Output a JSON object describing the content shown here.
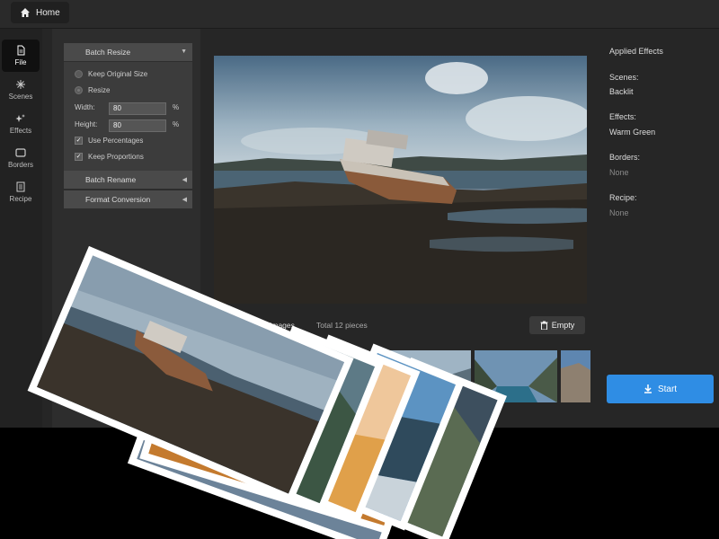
{
  "topbar": {
    "home_label": "Home",
    "home_icon": "home-icon"
  },
  "rail": {
    "items": [
      {
        "label": "File",
        "icon": "file-icon",
        "active": true
      },
      {
        "label": "Scenes",
        "icon": "sparkle-icon"
      },
      {
        "label": "Effects",
        "icon": "effects-icon"
      },
      {
        "label": "Borders",
        "icon": "border-icon"
      },
      {
        "label": "Recipe",
        "icon": "recipe-icon"
      }
    ]
  },
  "batch_resize": {
    "title": "Batch Resize",
    "keep_original_label": "Keep Original Size",
    "resize_label": "Resize",
    "width_label": "Width:",
    "width_value": "80",
    "height_label": "Height:",
    "height_value": "80",
    "unit": "%",
    "use_percentages_label": "Use Percentages",
    "use_percentages_checked": true,
    "keep_proportions_label": "Keep Proportions",
    "keep_proportions_checked": true
  },
  "batch_rename": {
    "title": "Batch Rename"
  },
  "format_conversion": {
    "title": "Format Conversion"
  },
  "applied": {
    "title": "Applied Effects",
    "scenes_label": "Scenes:",
    "scenes_value": "Backlit",
    "effects_label": "Effects:",
    "effects_value": "Warm Green",
    "borders_label": "Borders:",
    "borders_value": "None",
    "recipe_label": "Recipe:",
    "recipe_value": "None"
  },
  "images_bar": {
    "images_label": "Images",
    "total_label": "Total 12 pieces",
    "empty_label": "Empty"
  },
  "start_label": "Start",
  "colors": {
    "accent": "#2f8de4",
    "panel": "#3c3c3c",
    "background": "#262626"
  }
}
